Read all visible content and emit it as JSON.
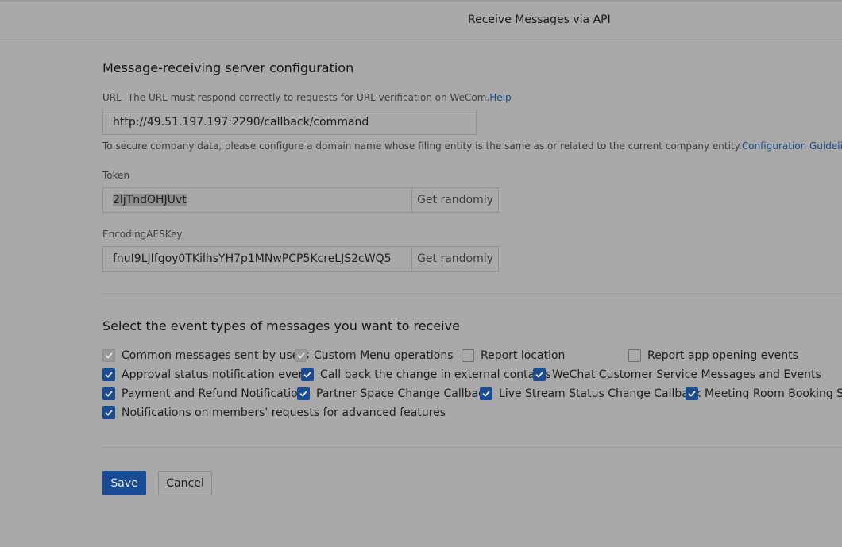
{
  "header": {
    "title": "Receive Messages via API"
  },
  "config": {
    "title": "Message-receiving server configuration",
    "url_label": "URL",
    "url_hint": "The URL must respond correctly to requests for URL verification on WeCom.",
    "url_help": "Help",
    "url_value": "http://49.51.197.197:2290/callback/command",
    "domain_note": "To secure company data, please configure a domain name whose filing entity is the same as or related to the current company entity.",
    "domain_note_link": "Configuration Guidelines",
    "token_label": "Token",
    "token_value": "2ljTndOHJUvt",
    "aes_label": "EncodingAESKey",
    "aes_value": "fnuI9LJIfgoy0TKilhsYH7p1MNwPCP5KcreLJS2cWQ5",
    "random_label": "Get randomly"
  },
  "events": {
    "title": "Select the event types of messages you want to receive",
    "items": [
      {
        "label": "Common messages sent by users",
        "state": "disabled"
      },
      {
        "label": "Custom Menu operations",
        "state": "disabled"
      },
      {
        "label": "Report location",
        "state": "unchecked"
      },
      {
        "label": "Report app opening events",
        "state": "unchecked"
      },
      {
        "label": "Approval status notification event",
        "state": "checked"
      },
      {
        "label": "Call back the change in external contacts",
        "state": "checked"
      },
      {
        "label": "WeChat Customer Service Messages and Events",
        "state": "checked"
      },
      {
        "label": "Payment and Refund Notification",
        "state": "checked"
      },
      {
        "label": "Partner Space Change Callback",
        "state": "checked"
      },
      {
        "label": "Live Stream Status Change Callback",
        "state": "checked"
      },
      {
        "label": "Meeting Room Booking Sta",
        "state": "checked"
      },
      {
        "label": "Notifications on members' requests for advanced features",
        "state": "checked"
      }
    ]
  },
  "actions": {
    "save": "Save",
    "cancel": "Cancel"
  },
  "colors": {
    "accent": "#1b4c93",
    "link": "#1c4a86",
    "overlay_bg": "#a9a9a9"
  }
}
